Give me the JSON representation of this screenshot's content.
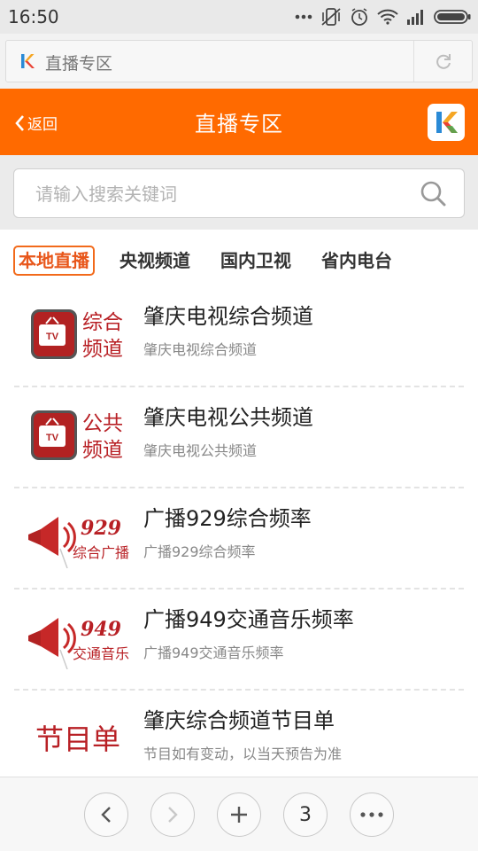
{
  "status_bar": {
    "time": "16:50",
    "icons": [
      "more-dots-icon",
      "vibrate-icon",
      "alarm-icon",
      "wifi-icon",
      "signal-icon",
      "battery-icon"
    ]
  },
  "browser": {
    "url_title": "直播专区",
    "favicon": "k-favicon",
    "reload_icon": "reload-icon"
  },
  "header": {
    "back_label": "返回",
    "title": "直播专区",
    "accent": "#ff6a00"
  },
  "search": {
    "placeholder": "请输入搜索关键词"
  },
  "tabs": [
    {
      "label": "本地直播",
      "active": true
    },
    {
      "label": "央视频道",
      "active": false
    },
    {
      "label": "国内卫视",
      "active": false
    },
    {
      "label": "省内电台",
      "active": false
    }
  ],
  "channels": [
    {
      "logo_text": [
        "综合",
        "频道"
      ],
      "title": "肇庆电视综合频道",
      "subtitle": "肇庆电视综合频道"
    },
    {
      "logo_text": [
        "公共",
        "频道"
      ],
      "title": "肇庆电视公共频道",
      "subtitle": "肇庆电视公共频道"
    },
    {
      "logo_text": [
        "929",
        "综合广播"
      ],
      "title": "广播929综合频率",
      "subtitle": "广播929综合频率"
    },
    {
      "logo_text": [
        "949",
        "交通音乐"
      ],
      "title": "广播949交通音乐频率",
      "subtitle": "广播949交通音乐频率"
    },
    {
      "logo_text": [
        "节目单"
      ],
      "title": "肇庆综合频道节目单",
      "subtitle": "节目如有变动，以当天预告为准"
    }
  ],
  "bottom_nav": {
    "tab_count": "3"
  }
}
